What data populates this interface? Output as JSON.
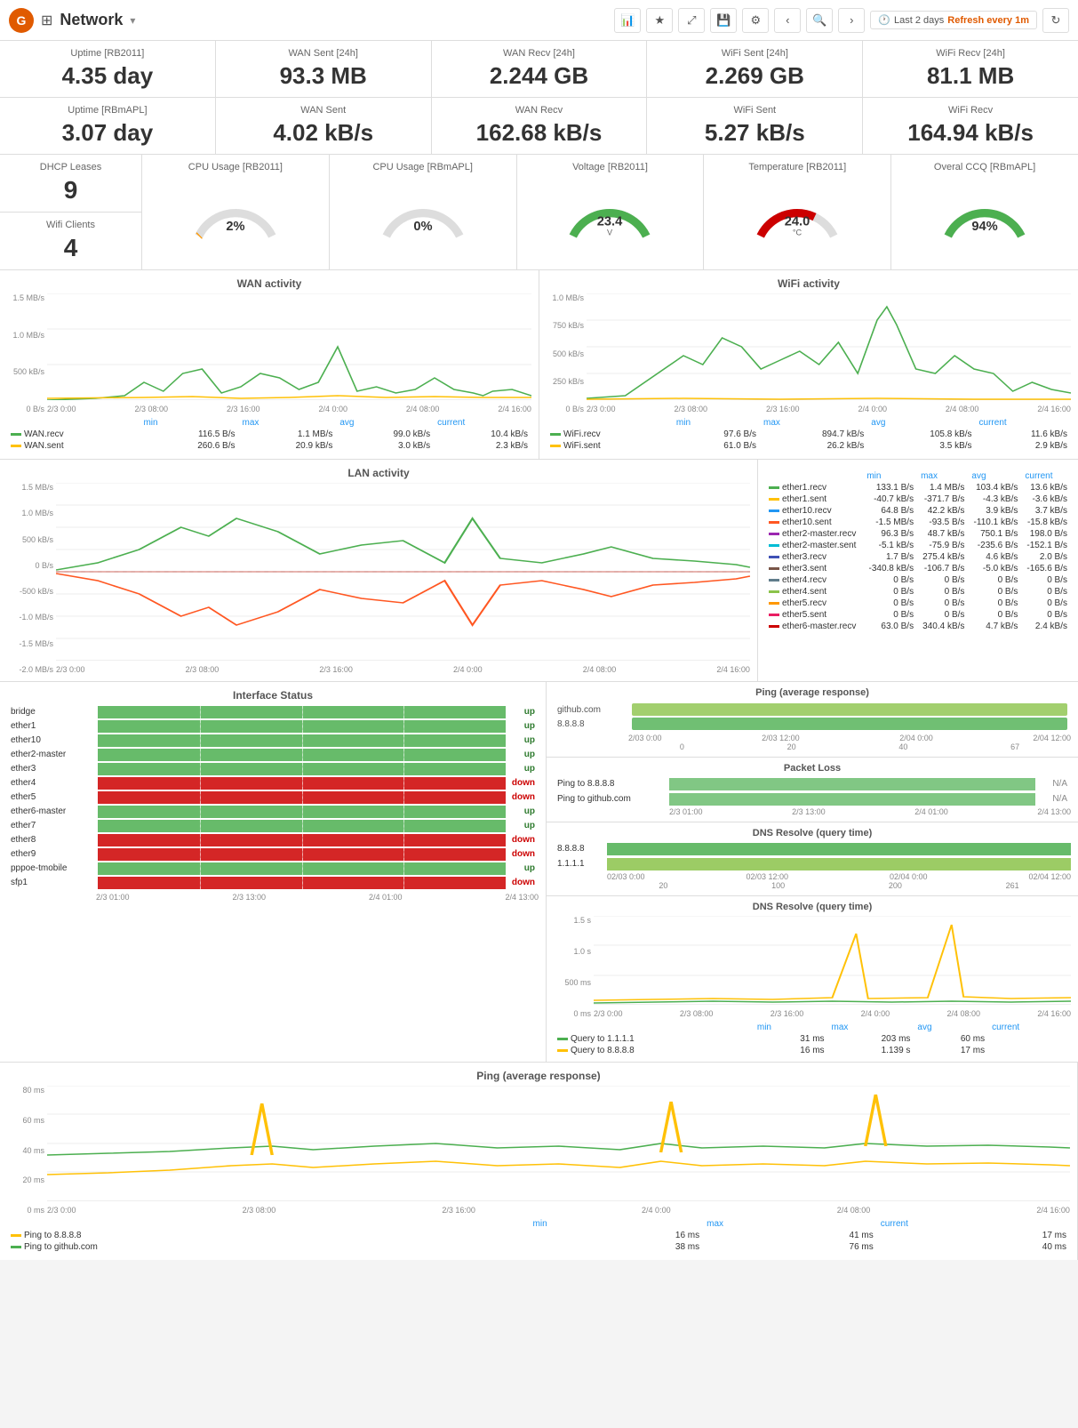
{
  "header": {
    "title": "Network",
    "dropdown": "▾",
    "time_label": "Last 2 days",
    "refresh_label": "Refresh every 1m",
    "logo_symbol": "G"
  },
  "stat_tiles_row1": [
    {
      "label": "Uptime [RB2011]",
      "value": "4.35 day"
    },
    {
      "label": "WAN Sent [24h]",
      "value": "93.3 MB"
    },
    {
      "label": "WAN Recv [24h]",
      "value": "2.244 GB"
    },
    {
      "label": "WiFi Sent [24h]",
      "value": "2.269 GB"
    },
    {
      "label": "WiFi Recv [24h]",
      "value": "81.1 MB"
    }
  ],
  "stat_tiles_row2": [
    {
      "label": "Uptime [RBmAPL]",
      "value": "3.07 day"
    },
    {
      "label": "WAN Sent",
      "value": "4.02 kB/s"
    },
    {
      "label": "WAN Recv",
      "value": "162.68 kB/s"
    },
    {
      "label": "WiFi Sent",
      "value": "5.27 kB/s"
    },
    {
      "label": "WiFi Recv",
      "value": "164.94 kB/s"
    }
  ],
  "stat_tiles_small": [
    {
      "label": "DHCP Leases",
      "value": "9"
    },
    {
      "label": "Wifi Clients",
      "value": "4"
    }
  ],
  "gauges": [
    {
      "label": "CPU Usage [RB2011]",
      "value": "2%",
      "percent": 2,
      "color_arc": "#FF9800"
    },
    {
      "label": "CPU Usage [RBmAPL]",
      "value": "0%",
      "percent": 0,
      "color_arc": "#FF9800"
    },
    {
      "label": "Voltage [RB2011]",
      "value": "23.4 V",
      "percent": 78,
      "color_arc": "#4CAF50"
    },
    {
      "label": "Temperature [RB2011]",
      "value": "24.0 °C",
      "percent": 50,
      "color_arc": "#c00"
    },
    {
      "label": "Overal CCQ [RBmAPL]",
      "value": "94%",
      "percent": 94,
      "color_arc": "#4CAF50"
    }
  ],
  "wan_chart": {
    "title": "WAN activity",
    "y_labels": [
      "1.5 MB/s",
      "1.0 MB/s",
      "500 kB/s",
      "0 B/s"
    ],
    "x_labels": [
      "2/3 0:00",
      "2/3 08:00",
      "2/3 16:00",
      "2/4 0:00",
      "2/4 08:00",
      "2/4 16:00"
    ],
    "legend": [
      {
        "name": "WAN.recv",
        "color": "#4CAF50",
        "min": "116.5 B/s",
        "max": "1.1 MB/s",
        "avg": "99.0 kB/s",
        "current": "10.4 kB/s"
      },
      {
        "name": "WAN.sent",
        "color": "#FFC107",
        "min": "260.6 B/s",
        "max": "20.9 kB/s",
        "avg": "3.0 kB/s",
        "current": "2.3 kB/s"
      }
    ]
  },
  "wifi_chart": {
    "title": "WiFi activity",
    "y_labels": [
      "1.0 MB/s",
      "750 kB/s",
      "500 kB/s",
      "250 kB/s",
      "0 B/s"
    ],
    "x_labels": [
      "2/3 0:00",
      "2/3 08:00",
      "2/3 16:00",
      "2/4 0:00",
      "2/4 08:00",
      "2/4 16:00"
    ],
    "legend": [
      {
        "name": "WiFi.recv",
        "color": "#4CAF50",
        "min": "97.6 B/s",
        "max": "894.7 kB/s",
        "avg": "105.8 kB/s",
        "current": "11.6 kB/s"
      },
      {
        "name": "WiFi.sent",
        "color": "#FFC107",
        "min": "61.0 B/s",
        "max": "26.2 kB/s",
        "avg": "3.5 kB/s",
        "current": "2.9 kB/s"
      }
    ]
  },
  "lan_chart": {
    "title": "LAN activity",
    "y_labels": [
      "1.5 MB/s",
      "1.0 MB/s",
      "500 kB/s",
      "0 B/s",
      "-500 kB/s",
      "-1.0 MB/s",
      "-1.5 MB/s",
      "-2.0 MB/s"
    ],
    "x_labels": [
      "2/3 0:00",
      "2/3 08:00",
      "2/3 16:00",
      "2/4 0:00",
      "2/4 08:00",
      "2/4 16:00"
    ],
    "legend": [
      {
        "name": "ether1.recv",
        "color": "#4CAF50",
        "min": "133.1 B/s",
        "max": "1.4 MB/s",
        "avg": "103.4 kB/s",
        "current": "13.6 kB/s"
      },
      {
        "name": "ether1.sent",
        "color": "#FFC107",
        "min": "-40.7 kB/s",
        "max": "-371.7 B/s",
        "avg": "-4.3 kB/s",
        "current": "-3.6 kB/s"
      },
      {
        "name": "ether10.recv",
        "color": "#2196F3",
        "min": "64.8 B/s",
        "max": "42.2 kB/s",
        "avg": "3.9 kB/s",
        "current": "3.7 kB/s"
      },
      {
        "name": "ether10.sent",
        "color": "#FF5722",
        "min": "-1.5 MB/s",
        "max": "-93.5 B/s",
        "avg": "-110.1 kB/s",
        "current": "-15.8 kB/s"
      },
      {
        "name": "ether2-master.recv",
        "color": "#9C27B0",
        "min": "96.3 B/s",
        "max": "48.7 kB/s",
        "avg": "750.1 B/s",
        "current": "198.0 B/s"
      },
      {
        "name": "ether2-master.sent",
        "color": "#00BCD4",
        "min": "-5.1 kB/s",
        "max": "-75.9 B/s",
        "avg": "-235.6 B/s",
        "current": "-152.1 B/s"
      },
      {
        "name": "ether3.recv",
        "color": "#3F51B5",
        "min": "1.7 B/s",
        "max": "275.4 kB/s",
        "avg": "4.6 kB/s",
        "current": "2.0 B/s"
      },
      {
        "name": "ether3.sent",
        "color": "#795548",
        "min": "-340.8 kB/s",
        "max": "-106.7 B/s",
        "avg": "-5.0 kB/s",
        "current": "-165.6 B/s"
      },
      {
        "name": "ether4.recv",
        "color": "#607D8B",
        "min": "0 B/s",
        "max": "0 B/s",
        "avg": "0 B/s",
        "current": "0 B/s"
      },
      {
        "name": "ether4.sent",
        "color": "#8BC34A",
        "min": "0 B/s",
        "max": "0 B/s",
        "avg": "0 B/s",
        "current": "0 B/s"
      },
      {
        "name": "ether5.recv",
        "color": "#FF9800",
        "min": "0 B/s",
        "max": "0 B/s",
        "avg": "0 B/s",
        "current": "0 B/s"
      },
      {
        "name": "ether5.sent",
        "color": "#E91E63",
        "min": "0 B/s",
        "max": "0 B/s",
        "avg": "0 B/s",
        "current": "0 B/s"
      },
      {
        "name": "ether6-master.recv",
        "color": "#c00",
        "min": "63.0 B/s",
        "max": "340.4 kB/s",
        "avg": "4.7 kB/s",
        "current": "2.4 kB/s"
      }
    ]
  },
  "interface_status": {
    "title": "Interface Status",
    "x_labels": [
      "2/3 01:00",
      "2/3 13:00",
      "2/4 01:00",
      "2/4 13:00"
    ],
    "interfaces": [
      {
        "name": "bridge",
        "status": "up",
        "state": "up"
      },
      {
        "name": "ether1",
        "status": "up",
        "state": "up"
      },
      {
        "name": "ether10",
        "status": "up",
        "state": "up"
      },
      {
        "name": "ether2-master",
        "status": "up",
        "state": "up"
      },
      {
        "name": "ether3",
        "status": "up",
        "state": "up"
      },
      {
        "name": "ether4",
        "status": "down",
        "state": "down"
      },
      {
        "name": "ether5",
        "status": "down",
        "state": "down"
      },
      {
        "name": "ether6-master",
        "status": "up",
        "state": "up"
      },
      {
        "name": "ether7",
        "status": "up",
        "state": "up"
      },
      {
        "name": "ether8",
        "status": "down",
        "state": "down"
      },
      {
        "name": "ether9",
        "status": "down",
        "state": "down"
      },
      {
        "name": "pppoe-tmobile",
        "status": "up",
        "state": "up"
      },
      {
        "name": "sfp1",
        "status": "down",
        "state": "down"
      }
    ]
  },
  "ping_avg_panel": {
    "title": "Ping (average response)",
    "hosts": [
      "github.com",
      "8.8.8.8"
    ],
    "x_labels": [
      "2/03 0:00",
      "2/03 12:00",
      "2/04 0:00",
      "2/04 12:00"
    ],
    "scale_labels": [
      "0",
      "20",
      "40",
      "67"
    ]
  },
  "packet_loss_panel": {
    "title": "Packet Loss",
    "rows": [
      {
        "label": "Ping to 8.8.8.8",
        "value": "N/A"
      },
      {
        "label": "Ping to github.com",
        "value": "N/A"
      }
    ],
    "x_labels": [
      "2/3 01:00",
      "2/3 13:00",
      "2/4 01:00",
      "2/4 13:00"
    ]
  },
  "dns_resolve_panel1": {
    "title": "DNS Resolve (query time)",
    "hosts": [
      "8.8.8.8",
      "1.1.1.1"
    ],
    "x_labels": [
      "02/03 0:00",
      "02/03 12:00",
      "02/04 0:00",
      "02/04 12:00"
    ],
    "scale_labels": [
      "20",
      "100",
      "200",
      "261"
    ]
  },
  "dns_resolve_panel2": {
    "title": "DNS Resolve (query time)",
    "y_labels": [
      "1.5 s",
      "1.0 s",
      "500 ms",
      "0 ms"
    ],
    "x_labels": [
      "2/3 0:00",
      "2/3 08:00",
      "2/3 16:00",
      "2/4 0:00",
      "2/4 08:00",
      "2/4 16:00"
    ],
    "legend": [
      {
        "name": "Query to 1.1.1.1",
        "color": "#4CAF50",
        "min": "31 ms",
        "max": "203 ms",
        "avg": "60 ms",
        "current": ""
      },
      {
        "name": "Query to 8.8.8.8",
        "color": "#FFC107",
        "min": "16 ms",
        "max": "1.139 s",
        "avg": "17 ms",
        "current": ""
      }
    ]
  },
  "ping_chart": {
    "title": "Ping (average response)",
    "y_labels": [
      "80 ms",
      "60 ms",
      "40 ms",
      "20 ms",
      "0 ms"
    ],
    "x_labels": [
      "2/3 0:00",
      "2/3 08:00",
      "2/3 16:00",
      "2/4 0:00",
      "2/4 08:00",
      "2/4 16:00"
    ],
    "legend": [
      {
        "name": "Ping to 8.8.8.8",
        "color": "#FFC107",
        "min": "16 ms",
        "max": "41 ms",
        "current": "17 ms"
      },
      {
        "name": "Ping to github.com",
        "color": "#4CAF50",
        "min": "38 ms",
        "max": "76 ms",
        "current": "40 ms"
      }
    ]
  }
}
